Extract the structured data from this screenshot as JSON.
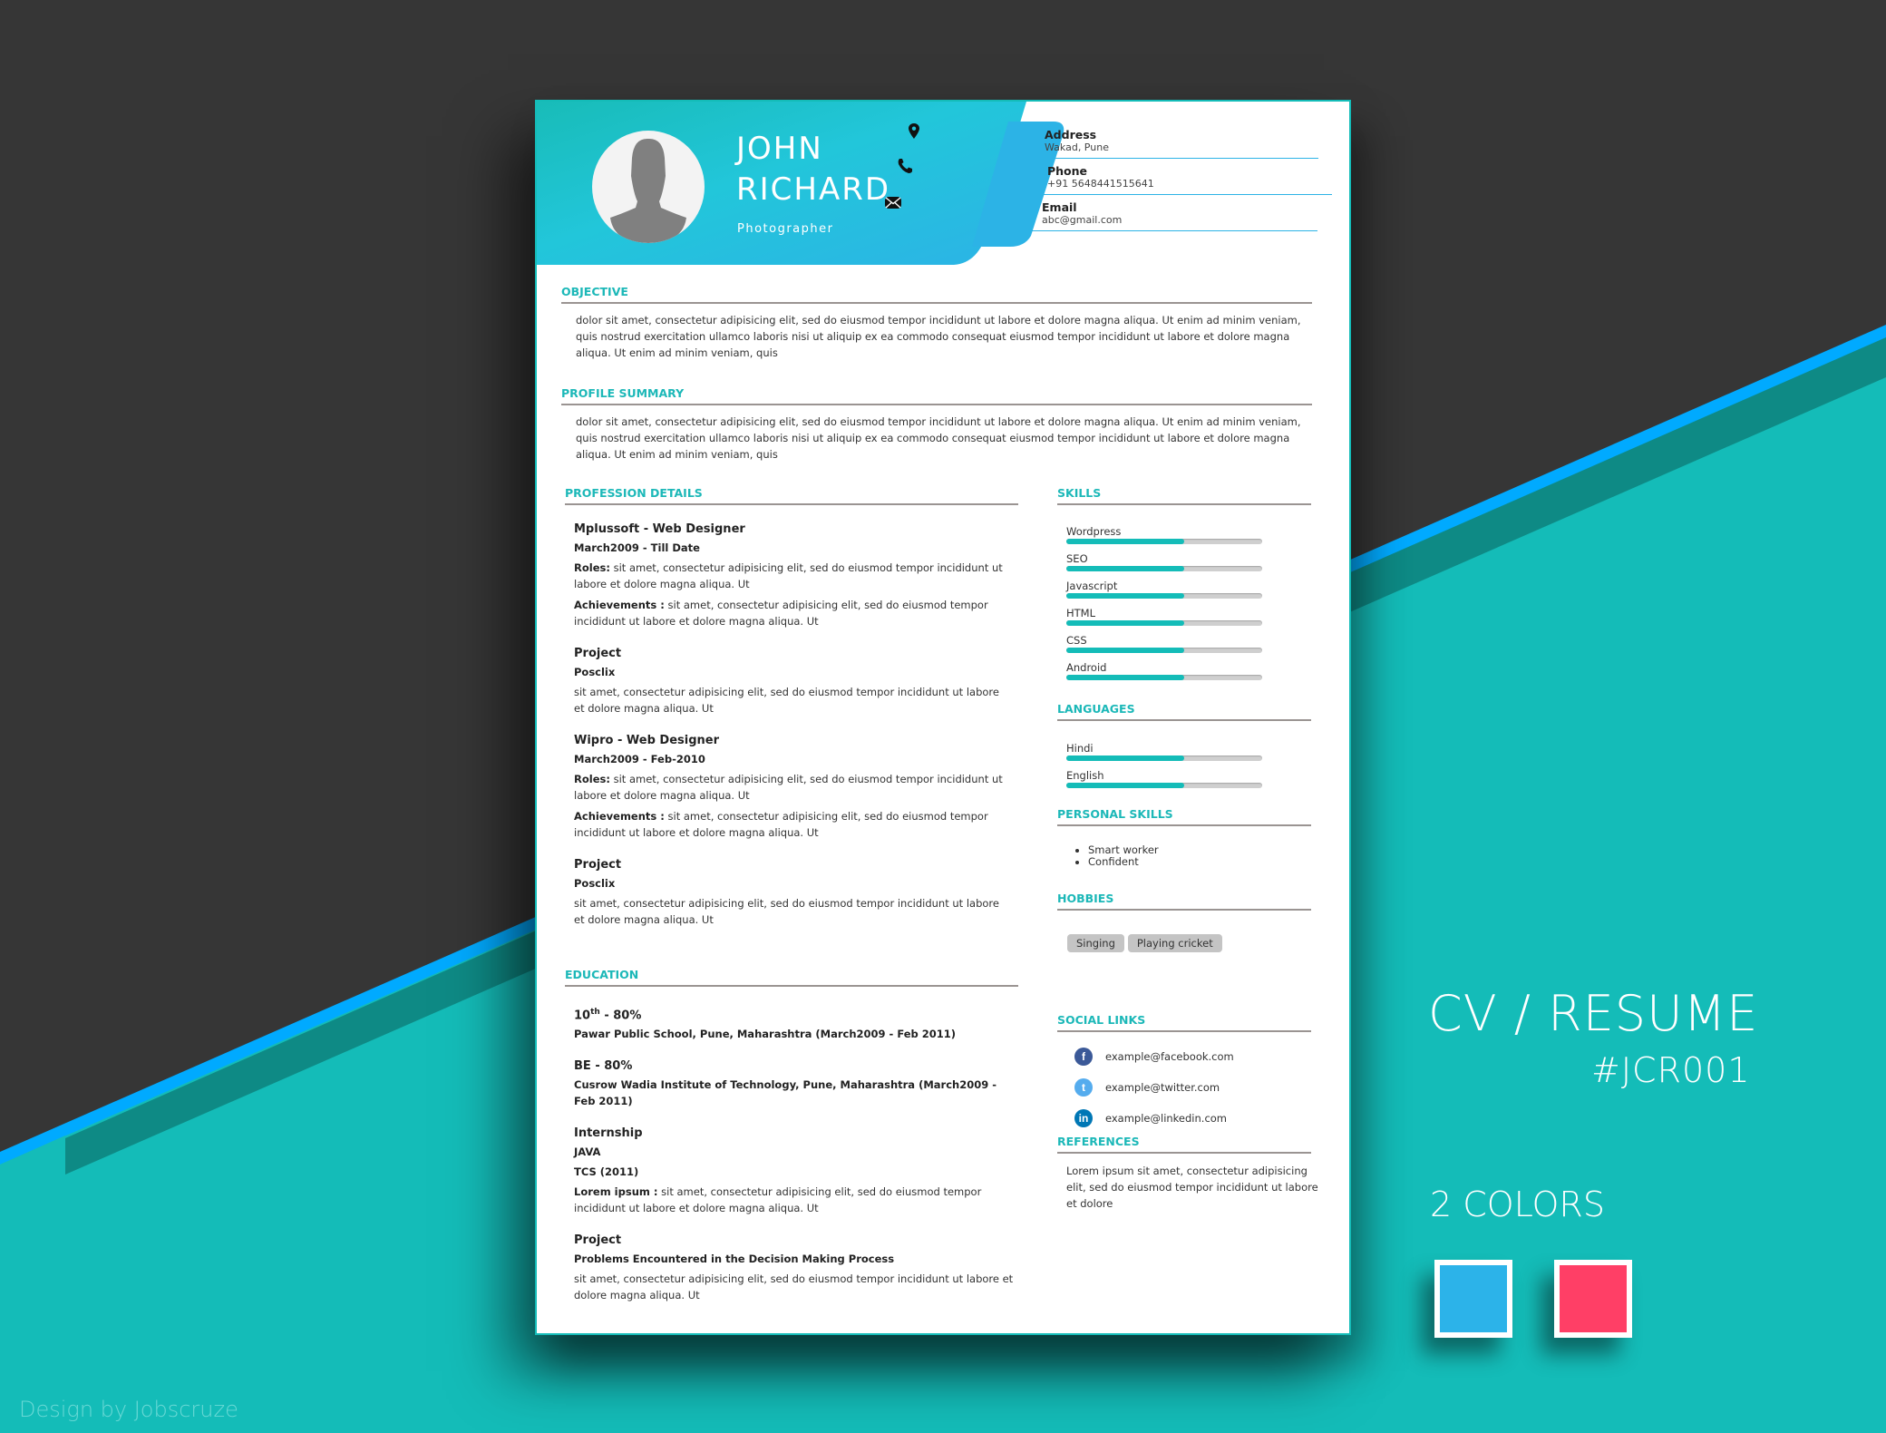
{
  "colors": {
    "accent": "#14bcb8",
    "header_blue": "#2cb3e6",
    "background_dark": "#363636",
    "background_teal": "#14bcb8",
    "stripe_blue": "#00aaff",
    "stripe_dark_teal": "#0e8a85"
  },
  "header": {
    "first_name": "JOHN",
    "last_name": "RICHARD",
    "role": "Photographer",
    "contact": [
      {
        "icon": "map-pin-icon",
        "label": "Address",
        "value": "Wakad, Pune"
      },
      {
        "icon": "phone-icon",
        "label": "Phone",
        "value": "+91 5648441515641"
      },
      {
        "icon": "envelope-icon",
        "label": "Email",
        "value": "abc@gmail.com"
      }
    ]
  },
  "objective": {
    "title": "OBJECTIVE",
    "text": "dolor sit amet, consectetur adipisicing elit, sed do eiusmod tempor incididunt ut labore et dolore magna aliqua. Ut enim ad minim veniam, quis nostrud exercitation ullamco laboris nisi ut aliquip ex ea commodo consequat eiusmod tempor incididunt ut labore et dolore magna aliqua. Ut enim ad minim veniam, quis"
  },
  "profile_summary": {
    "title": "PROFILE SUMMARY",
    "text": "dolor sit amet, consectetur adipisicing elit, sed do eiusmod tempor incididunt ut labore et dolore magna aliqua. Ut enim ad minim veniam, quis nostrud exercitation ullamco laboris nisi ut aliquip ex ea commodo consequat eiusmod tempor incididunt ut labore et dolore magna aliqua. Ut enim ad minim veniam, quis"
  },
  "profession": {
    "title": "PROFESSION DETAILS",
    "jobs": [
      {
        "heading": "Mplussoft - Web Designer",
        "period": "March2009 - Till Date",
        "roles_label": "Roles:",
        "roles": " sit amet, consectetur adipisicing elit, sed do eiusmod tempor incididunt ut labore et dolore magna aliqua. Ut",
        "achievements_label": "Achievements :",
        "achievements": " sit amet, consectetur adipisicing elit, sed do eiusmod tempor incididunt ut labore et dolore magna aliqua. Ut"
      },
      {
        "heading": "Project",
        "period": "Posclix",
        "text": "sit amet, consectetur adipisicing elit, sed do eiusmod tempor incididunt ut labore et dolore magna aliqua. Ut"
      },
      {
        "heading": "Wipro - Web Designer",
        "period": "March2009 - Feb-2010",
        "roles_label": "Roles:",
        "roles": " sit amet, consectetur adipisicing elit, sed do eiusmod tempor incididunt ut labore et dolore magna aliqua. Ut",
        "achievements_label": "Achievements :",
        "achievements": " sit amet, consectetur adipisicing elit, sed do eiusmod tempor incididunt ut labore et dolore magna aliqua. Ut"
      },
      {
        "heading": "Project",
        "period": "Posclix",
        "text": "sit amet, consectetur adipisicing elit, sed do eiusmod tempor incididunt ut labore et dolore magna aliqua. Ut"
      }
    ]
  },
  "education": {
    "title": "EDUCATION",
    "items": [
      {
        "heading_main": "10",
        "heading_sup": "th",
        "heading_rest": " - 80%",
        "detail": "Pawar Public School, Pune, Maharashtra (March2009 - Feb 2011)"
      },
      {
        "heading_main": "BE - 80%",
        "heading_sup": "",
        "heading_rest": "",
        "detail": "Cusrow Wadia Institute of Technology, Pune, Maharashtra (March2009 - Feb 2011)"
      }
    ],
    "internship": {
      "heading": "Internship",
      "subject": "JAVA",
      "company": "TCS (2011)",
      "label": "Lorem ipsum :",
      "text": " sit amet, consectetur adipisicing elit, sed do eiusmod tempor incididunt ut labore et dolore magna aliqua. Ut"
    },
    "project": {
      "heading": "Project",
      "name": "Problems Encountered in the Decision Making Process",
      "text": "sit amet, consectetur adipisicing elit, sed do eiusmod tempor incididunt ut labore et dolore magna aliqua. Ut"
    }
  },
  "skills": {
    "title": "SKILLS",
    "items": [
      {
        "name": "Wordpress",
        "level": 0.6
      },
      {
        "name": "SEO",
        "level": 0.6
      },
      {
        "name": "Javascript",
        "level": 0.6
      },
      {
        "name": "HTML",
        "level": 0.6
      },
      {
        "name": "CSS",
        "level": 0.6
      },
      {
        "name": "Android",
        "level": 0.6
      }
    ]
  },
  "languages": {
    "title": "LANGUAGES",
    "items": [
      {
        "name": "Hindi",
        "level": 0.6
      },
      {
        "name": "English",
        "level": 0.6
      }
    ]
  },
  "personal_skills": {
    "title": "PERSONAL SKILLS",
    "items": [
      "Smart worker",
      "Confident"
    ]
  },
  "hobbies": {
    "title": "HOBBIES",
    "items": [
      "Singing",
      "Playing cricket"
    ]
  },
  "social": {
    "title": "SOCIAL LINKS",
    "items": [
      {
        "icon": "facebook-icon",
        "glyph": "f",
        "color": "#3b5998",
        "text": "example@facebook.com"
      },
      {
        "icon": "twitter-icon",
        "glyph": "t",
        "color": "#55acee",
        "text": "example@twitter.com"
      },
      {
        "icon": "linkedin-icon",
        "glyph": "in",
        "color": "#0077b5",
        "text": "example@linkedin.com"
      }
    ]
  },
  "references": {
    "title": "REFERENCES",
    "text": "Lorem ipsum sit amet, consectetur adipisicing elit, sed do eiusmod tempor incididunt ut labore et dolore"
  },
  "promo": {
    "title": "CV / RESUME",
    "code": "#JCR001",
    "colors_label": "2 COLORS",
    "swatches": [
      "#2cb3e9",
      "#ff3f66"
    ],
    "credit": "Design by Jobscruze"
  }
}
